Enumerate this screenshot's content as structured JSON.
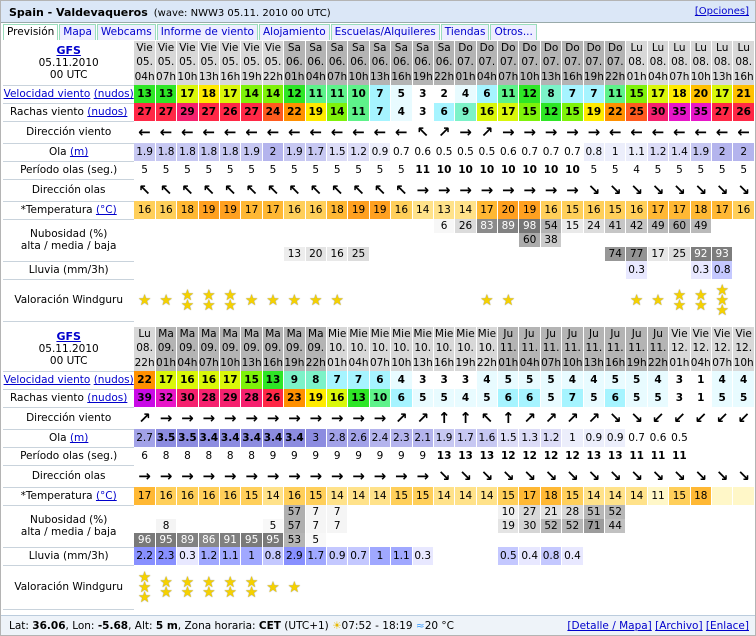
{
  "header": {
    "location": "Spain - Valdevaqueros",
    "wave_info": "(wave: NWW3 05.11. 2010 00 UTC)",
    "options": "[Opciones]"
  },
  "tabs": [
    {
      "label": "Previsión",
      "active": true
    },
    {
      "label": "Mapa"
    },
    {
      "label": "Webcams"
    },
    {
      "label": "Informe de viento"
    },
    {
      "label": "Alojamiento"
    },
    {
      "label": "Escuelas/Alquileres"
    },
    {
      "label": "Tiendas"
    },
    {
      "label": "Otros..."
    }
  ],
  "labels": {
    "model": "GFS",
    "date": "05.11.2010",
    "utc": "00 UTC",
    "wind_speed": "Velocidad viento",
    "gusts": "Rachas viento",
    "knots": "(nudos)",
    "wind_dir": "Dirección viento",
    "wave": "Ola",
    "wave_unit": "(m)",
    "period": "Período olas (seg.)",
    "wave_dir": "Dirección olas",
    "temp": "*Temperatura",
    "temp_unit": "(°C)",
    "cloud": "Nubosidad (%)",
    "cloud2": "alta / media / baja",
    "rain": "Lluvia (mm/3h)",
    "rating": "Valoración Windguru"
  },
  "colors": {
    "tab_bg": "#eef",
    "header_bg": "#dbe7f7",
    "weekend": "#b4b4b4",
    "weekday": "#d8d8d8",
    "link": "#00c"
  },
  "blocks": [
    {
      "days": [
        "Vie",
        "Vie",
        "Vie",
        "Vie",
        "Vie",
        "Vie",
        "Vie",
        "Sa",
        "Sa",
        "Sa",
        "Sa",
        "Sa",
        "Sa",
        "Sa",
        "Sa",
        "Do",
        "Do",
        "Do",
        "Do",
        "Do",
        "Do",
        "Do",
        "Do",
        "Lu",
        "Lu",
        "Lu",
        "Lu",
        "Lu",
        "Lu"
      ],
      "dates": [
        "05.",
        "05.",
        "05.",
        "05.",
        "05.",
        "05.",
        "05.",
        "06.",
        "06.",
        "06.",
        "06.",
        "06.",
        "06.",
        "06.",
        "06.",
        "07.",
        "07.",
        "07.",
        "07.",
        "07.",
        "07.",
        "07.",
        "07.",
        "08.",
        "08.",
        "08.",
        "08.",
        "08.",
        "08."
      ],
      "hours": [
        "04h",
        "07h",
        "10h",
        "13h",
        "16h",
        "19h",
        "22h",
        "01h",
        "04h",
        "07h",
        "10h",
        "13h",
        "16h",
        "19h",
        "22h",
        "01h",
        "04h",
        "07h",
        "10h",
        "13h",
        "16h",
        "19h",
        "22h",
        "01h",
        "04h",
        "07h",
        "10h",
        "13h",
        "16h"
      ],
      "weekend": [
        false,
        false,
        false,
        false,
        false,
        false,
        false,
        true,
        true,
        true,
        true,
        true,
        true,
        true,
        true,
        true,
        true,
        true,
        true,
        true,
        true,
        true,
        true,
        false,
        false,
        false,
        false,
        false,
        false
      ],
      "wind": [
        "13",
        "13",
        "17",
        "18",
        "17",
        "14",
        "14",
        "12",
        "11",
        "11",
        "10",
        "7",
        "5",
        "3",
        "2",
        "4",
        "6",
        "11",
        "12",
        "8",
        "7",
        "7",
        "11",
        "15",
        "17",
        "18",
        "20",
        "17",
        "21"
      ],
      "gust": [
        "27",
        "27",
        "29",
        "27",
        "26",
        "27",
        "24",
        "22",
        "19",
        "14",
        "11",
        "7",
        "4",
        "3",
        "6",
        "9",
        "16",
        "17",
        "15",
        "12",
        "15",
        "19",
        "22",
        "25",
        "30",
        "35",
        "35",
        "27",
        "26"
      ],
      "wdir": [
        "←",
        "←",
        "←",
        "←",
        "←",
        "←",
        "←",
        "←",
        "←",
        "←",
        "←",
        "←",
        "←",
        "↖",
        "↗",
        "→",
        "↗",
        "→",
        "→",
        "→",
        "→",
        "→",
        "←",
        "←",
        "←",
        "←",
        "←",
        "←",
        "←"
      ],
      "wave": [
        "1.9",
        "1.8",
        "1.8",
        "1.8",
        "1.8",
        "1.9",
        "2",
        "1.9",
        "1.7",
        "1.5",
        "1.2",
        "0.9",
        "0.7",
        "0.6",
        "0.5",
        "0.5",
        "0.5",
        "0.6",
        "0.7",
        "0.7",
        "0.7",
        "0.8",
        "1",
        "1.1",
        "1.2",
        "1.4",
        "1.9",
        "2",
        "2"
      ],
      "period": [
        "5",
        "5",
        "5",
        "5",
        "5",
        "5",
        "5",
        "5",
        "5",
        "5",
        "5",
        "5",
        "5",
        "11",
        "10",
        "10",
        "10",
        "10",
        "10",
        "10",
        "10",
        "5",
        "5",
        "4",
        "5",
        "5",
        "5",
        "5",
        "5"
      ],
      "pbold": [
        false,
        false,
        false,
        false,
        false,
        false,
        false,
        false,
        false,
        false,
        false,
        false,
        false,
        true,
        true,
        true,
        true,
        true,
        true,
        true,
        true,
        false,
        false,
        false,
        false,
        false,
        false,
        false,
        false
      ],
      "wvdir": [
        "↖",
        "↖",
        "↖",
        "↖",
        "↖",
        "↖",
        "↖",
        "↖",
        "↖",
        "↖",
        "↖",
        "↖",
        "↖",
        "→",
        "→",
        "→",
        "→",
        "→",
        "→",
        "→",
        "→",
        "↘",
        "↘",
        "↘",
        "↘",
        "↘",
        "↘",
        "↘",
        "↘"
      ],
      "temp": [
        "16",
        "16",
        "18",
        "19",
        "19",
        "17",
        "17",
        "16",
        "16",
        "18",
        "19",
        "19",
        "16",
        "14",
        "13",
        "14",
        "17",
        "20",
        "19",
        "16",
        "15",
        "16",
        "15",
        "16",
        "17",
        "17",
        "18",
        "17",
        "16"
      ],
      "cloud_high": [
        "",
        "",
        "",
        "",
        "",
        "",
        "",
        "",
        "",
        "",
        "",
        "",
        "",
        "",
        "6",
        "26",
        "83",
        "89",
        "98",
        "54",
        "15",
        "24",
        "41",
        "42",
        "49",
        "60",
        "49",
        "",
        ""
      ],
      "cloud_mid": [
        "",
        "",
        "",
        "",
        "",
        "",
        "",
        "",
        "",
        "",
        "",
        "",
        "",
        "",
        "",
        "",
        "",
        "",
        "60",
        "38",
        "",
        "",
        "",
        "",
        "",
        "",
        "",
        "",
        ""
      ],
      "cloud_low": [
        "",
        "",
        "",
        "",
        "",
        "",
        "",
        "13",
        "20",
        "16",
        "25",
        "",
        "",
        "",
        "",
        "",
        "",
        "",
        "",
        "",
        "",
        "",
        "74",
        "77",
        "17",
        "25",
        "92",
        "93",
        ""
      ],
      "rain": [
        "",
        "",
        "",
        "",
        "",
        "",
        "",
        "",
        "",
        "",
        "",
        "",
        "",
        "",
        "",
        "",
        "",
        "",
        "",
        "",
        "",
        "",
        "",
        "0.3",
        "",
        "",
        "0.3",
        "0.8",
        ""
      ],
      "stars": [
        1,
        1,
        2,
        2,
        2,
        1,
        1,
        1,
        1,
        1,
        0,
        0,
        0,
        0,
        0,
        0,
        1,
        1,
        0,
        0,
        0,
        0,
        0,
        1,
        1,
        2,
        2,
        3,
        0
      ]
    },
    {
      "days": [
        "Lu",
        "Ma",
        "Ma",
        "Ma",
        "Ma",
        "Ma",
        "Ma",
        "Ma",
        "Ma",
        "Mie",
        "Mie",
        "Mie",
        "Mie",
        "Mie",
        "Mie",
        "Mie",
        "Mie",
        "Ju",
        "Ju",
        "Ju",
        "Ju",
        "Ju",
        "Ju",
        "Ju",
        "Ju",
        "Vie",
        "Vie",
        "Vie",
        "Vie"
      ],
      "dates": [
        "08.",
        "09.",
        "09.",
        "09.",
        "09.",
        "09.",
        "09.",
        "09.",
        "09.",
        "10.",
        "10.",
        "10.",
        "10.",
        "10.",
        "10.",
        "10.",
        "10.",
        "11.",
        "11.",
        "11.",
        "11.",
        "11.",
        "11.",
        "11.",
        "11.",
        "12.",
        "12.",
        "12.",
        "12."
      ],
      "hours": [
        "22h",
        "01h",
        "04h",
        "07h",
        "10h",
        "13h",
        "16h",
        "19h",
        "22h",
        "01h",
        "04h",
        "07h",
        "10h",
        "13h",
        "16h",
        "19h",
        "22h",
        "01h",
        "04h",
        "07h",
        "10h",
        "13h",
        "16h",
        "19h",
        "22h",
        "01h",
        "04h",
        "07h",
        "10h"
      ],
      "weekend": [
        false,
        true,
        true,
        true,
        true,
        true,
        true,
        true,
        true,
        false,
        false,
        false,
        false,
        false,
        false,
        false,
        false,
        true,
        true,
        true,
        true,
        true,
        true,
        true,
        true,
        false,
        false,
        false,
        false
      ],
      "wind": [
        "22",
        "17",
        "16",
        "16",
        "17",
        "15",
        "13",
        "9",
        "8",
        "7",
        "7",
        "6",
        "4",
        "3",
        "3",
        "3",
        "4",
        "5",
        "5",
        "5",
        "4",
        "4",
        "5",
        "5",
        "4",
        "3",
        "1",
        "4",
        "4"
      ],
      "gust": [
        "39",
        "32",
        "30",
        "28",
        "29",
        "28",
        "26",
        "23",
        "19",
        "16",
        "13",
        "10",
        "6",
        "5",
        "5",
        "4",
        "5",
        "6",
        "6",
        "5",
        "7",
        "5",
        "6",
        "5",
        "5",
        "3",
        "1",
        "5",
        "5"
      ],
      "wdir": [
        "↗",
        "→",
        "→",
        "→",
        "→",
        "→",
        "→",
        "→",
        "→",
        "→",
        "→",
        "→",
        "↗",
        "↗",
        "↑",
        "↑",
        "↖",
        "↑",
        "↗",
        "↗",
        "↗",
        "↗",
        "↘",
        "↘",
        "↙",
        "↙",
        "↙",
        "↙",
        "↙"
      ],
      "wave": [
        "2.7",
        "3.5",
        "3.5",
        "3.4",
        "3.4",
        "3.4",
        "3.4",
        "3.4",
        "3",
        "2.8",
        "2.6",
        "2.4",
        "2.3",
        "2.1",
        "1.9",
        "1.7",
        "1.6",
        "1.5",
        "1.3",
        "1.2",
        "1",
        "0.9",
        "0.9",
        "0.7",
        "0.6",
        "0.5",
        "",
        ""
      ],
      "period": [
        "6",
        "8",
        "8",
        "8",
        "8",
        "8",
        "9",
        "9",
        "9",
        "9",
        "9",
        "9",
        "9",
        "9",
        "13",
        "13",
        "13",
        "12",
        "12",
        "12",
        "12",
        "13",
        "13",
        "11",
        "11",
        "11",
        "",
        "",
        ""
      ],
      "pbold": [
        false,
        false,
        false,
        false,
        false,
        false,
        false,
        false,
        false,
        false,
        false,
        false,
        false,
        false,
        true,
        true,
        true,
        true,
        true,
        true,
        true,
        true,
        true,
        true,
        true,
        true,
        false,
        false,
        false
      ],
      "wvdir": [
        "→",
        "→",
        "→",
        "→",
        "→",
        "→",
        "→",
        "→",
        "→",
        "→",
        "→",
        "→",
        "→",
        "→",
        "↘",
        "↘",
        "↘",
        "↘",
        "↘",
        "↘",
        "↘",
        "↘",
        "↘",
        "↘",
        "↘",
        "↘",
        "↘",
        "↘",
        "↘"
      ],
      "temp": [
        "17",
        "16",
        "16",
        "16",
        "16",
        "15",
        "14",
        "16",
        "15",
        "14",
        "14",
        "14",
        "15",
        "15",
        "14",
        "14",
        "14",
        "15",
        "17",
        "18",
        "15",
        "14",
        "14",
        "14",
        "11",
        "15",
        "18",
        "",
        ""
      ],
      "cloud_high": [
        "",
        "",
        "",
        "",
        "",
        "",
        "",
        "57",
        "7",
        "7",
        "",
        "",
        "",
        "",
        "",
        "",
        "",
        "10",
        "27",
        "21",
        "28",
        "51",
        "52",
        "",
        "",
        "",
        "",
        "",
        ""
      ],
      "cloud_mid": [
        "",
        "8",
        "",
        "",
        "",
        "",
        "5",
        "57",
        "7",
        "7",
        "",
        "",
        "",
        "",
        "",
        "",
        "",
        "19",
        "30",
        "52",
        "52",
        "71",
        "44",
        "",
        "",
        "",
        "",
        "",
        ""
      ],
      "cloud_low": [
        "96",
        "95",
        "89",
        "86",
        "91",
        "95",
        "95",
        "53",
        "5",
        "",
        "",
        "",
        "",
        "",
        "",
        "",
        "",
        "",
        "",
        "",
        "",
        "",
        "",
        "",
        "",
        "",
        "",
        "",
        ""
      ],
      "rain": [
        "2.2",
        "2.3",
        "0.3",
        "1.2",
        "1.1",
        "1",
        "0.8",
        "2.9",
        "1.7",
        "0.9",
        "0.7",
        "1",
        "1.1",
        "0.3",
        "",
        "",
        "",
        "0.5",
        "0.4",
        "0.8",
        "0.4",
        "",
        "",
        "",
        "",
        "",
        "",
        "",
        ""
      ],
      "stars": [
        3,
        2,
        2,
        2,
        2,
        2,
        1,
        1,
        0,
        0,
        0,
        0,
        0,
        0,
        0,
        0,
        0,
        0,
        0,
        0,
        0,
        0,
        0,
        0,
        0,
        0,
        0,
        0,
        0
      ]
    }
  ],
  "footer": {
    "lat": "Lat:",
    "lat_v": "36.06",
    "lon": ", Lon:",
    "lon_v": "-5.68",
    "alt": ", Alt:",
    "alt_v": "5 m",
    "tz": ", Zona horaria:",
    "tz_v": "CET",
    "utc": "(UTC+1)",
    "sun": "07:52 - 18:19",
    "water": "20 °C",
    "detail": "[Detalle / Mapa]",
    "archive": "[Archivo]",
    "link": "[Enlace]"
  }
}
